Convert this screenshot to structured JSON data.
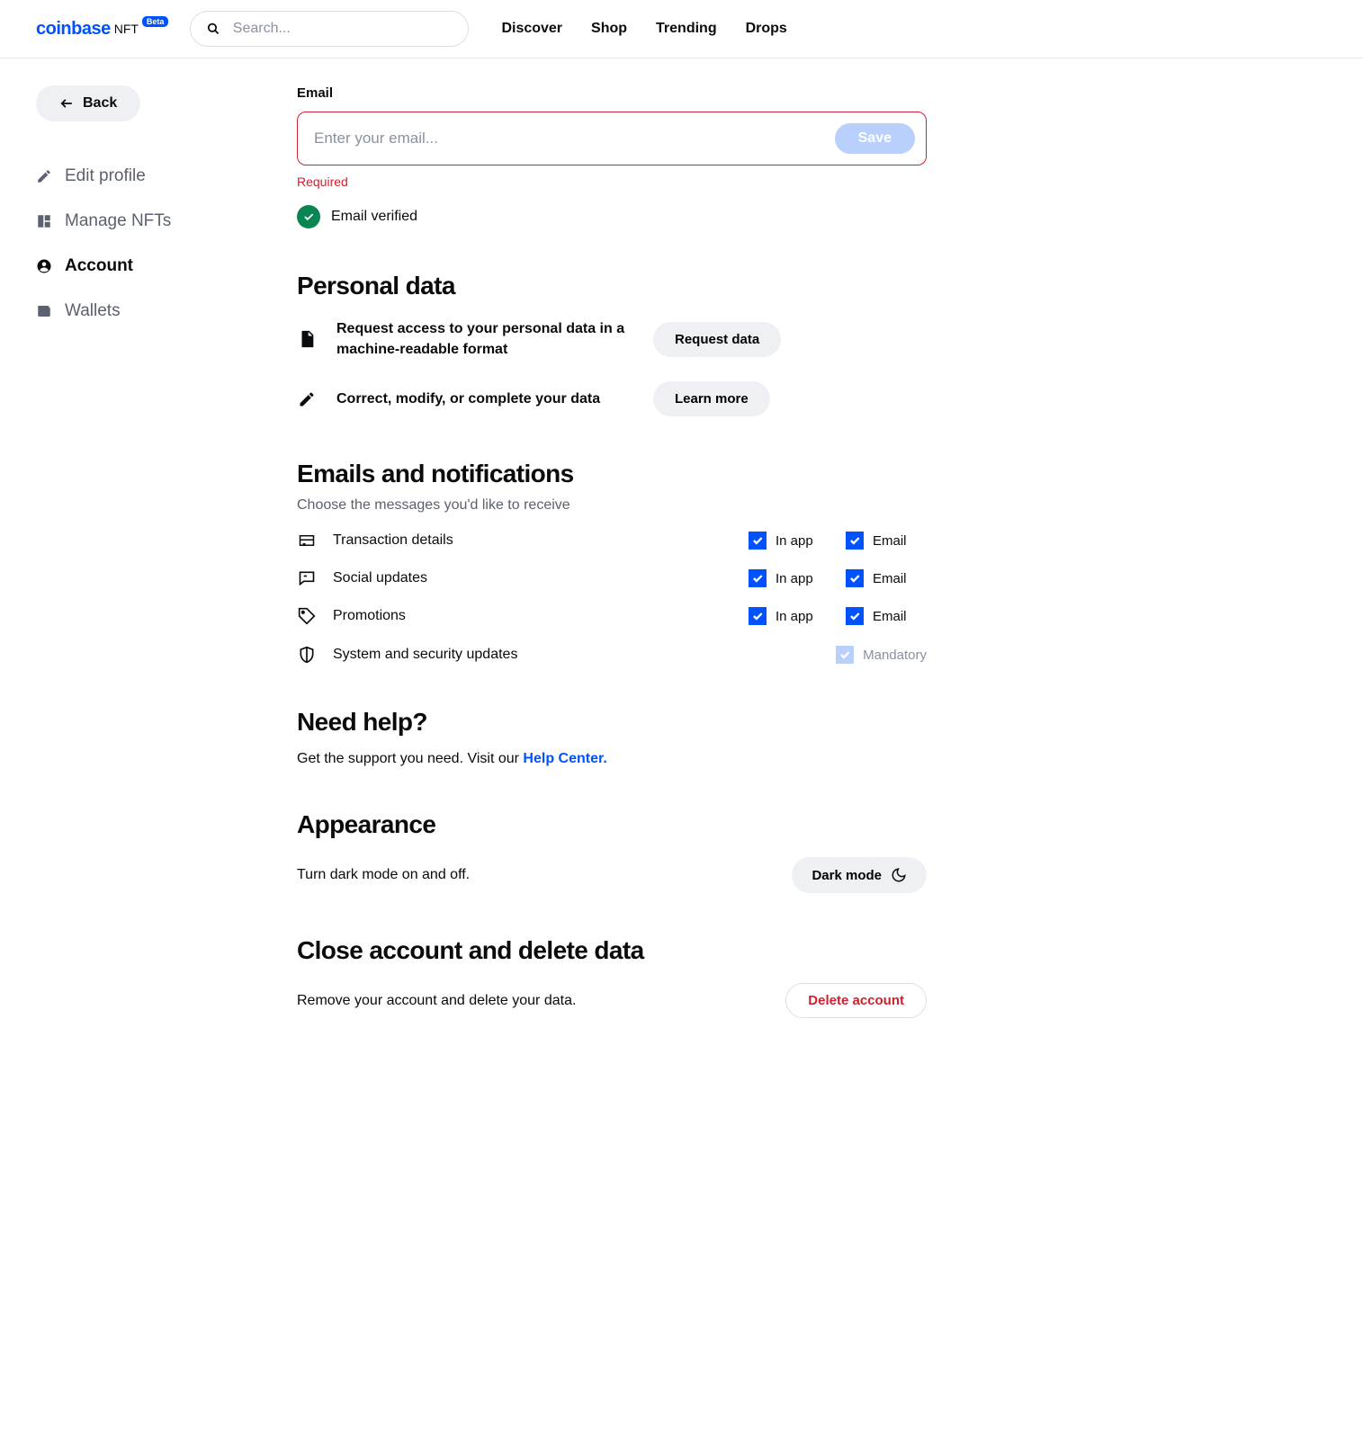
{
  "header": {
    "logo_main": "coinbase",
    "logo_sub": "NFT",
    "badge": "Beta",
    "search_placeholder": "Search...",
    "nav": [
      "Discover",
      "Shop",
      "Trending",
      "Drops"
    ]
  },
  "sidebar": {
    "back": "Back",
    "items": [
      {
        "label": "Edit profile",
        "active": false
      },
      {
        "label": "Manage NFTs",
        "active": false
      },
      {
        "label": "Account",
        "active": true
      },
      {
        "label": "Wallets",
        "active": false
      }
    ]
  },
  "email": {
    "label": "Email",
    "placeholder": "Enter your email...",
    "save": "Save",
    "error": "Required",
    "verified": "Email verified"
  },
  "personal": {
    "heading": "Personal data",
    "request_text": "Request access to your personal data in a machine-readable format",
    "request_btn": "Request data",
    "correct_text": "Correct, modify, or complete your data",
    "learn_btn": "Learn more"
  },
  "notifications": {
    "heading": "Emails and notifications",
    "sub": "Choose the messages you'd like to receive",
    "rows": [
      {
        "label": "Transaction details",
        "inapp": "In app",
        "email": "Email"
      },
      {
        "label": "Social updates",
        "inapp": "In app",
        "email": "Email"
      },
      {
        "label": "Promotions",
        "inapp": "In app",
        "email": "Email"
      }
    ],
    "system_label": "System and security updates",
    "mandatory": "Mandatory"
  },
  "help": {
    "heading": "Need help?",
    "text": "Get the support you need. Visit our ",
    "link": "Help Center."
  },
  "appearance": {
    "heading": "Appearance",
    "text": "Turn dark mode on and off.",
    "btn": "Dark mode"
  },
  "close": {
    "heading": "Close account and delete data",
    "text": "Remove your account and delete your data.",
    "btn": "Delete account"
  }
}
